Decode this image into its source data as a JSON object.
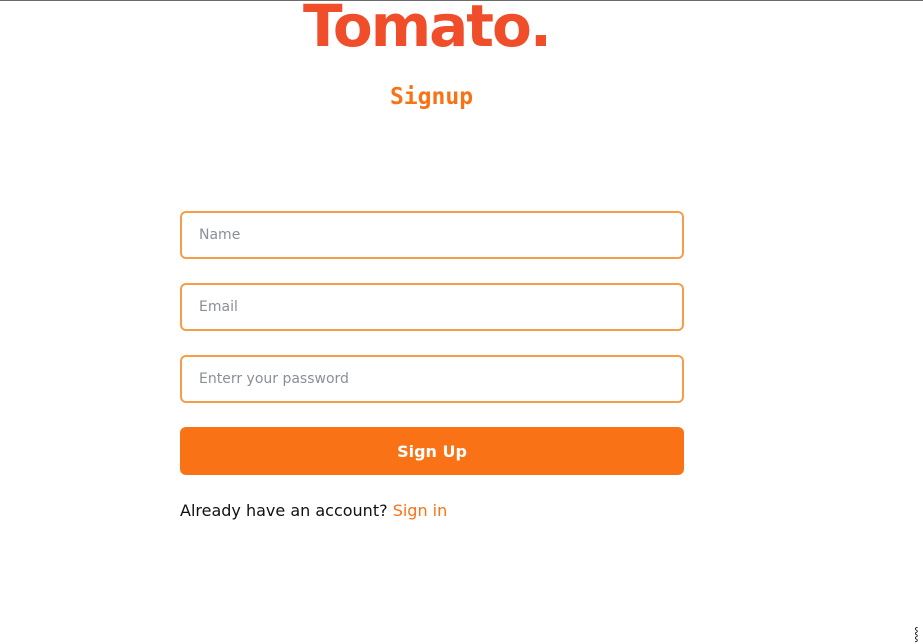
{
  "brand": {
    "logo_text": "Tomato.",
    "color": "#f04d2a"
  },
  "page": {
    "title": "Signup",
    "accent": "#f97316"
  },
  "form": {
    "name_placeholder": "Name",
    "email_placeholder": "Email",
    "password_placeholder": "Enterr your password",
    "submit_label": "Sign Up"
  },
  "footer": {
    "prompt": "Already have an account?",
    "link_label": "Sign in"
  },
  "icons": {
    "cursor": "text-cursor-icon"
  }
}
